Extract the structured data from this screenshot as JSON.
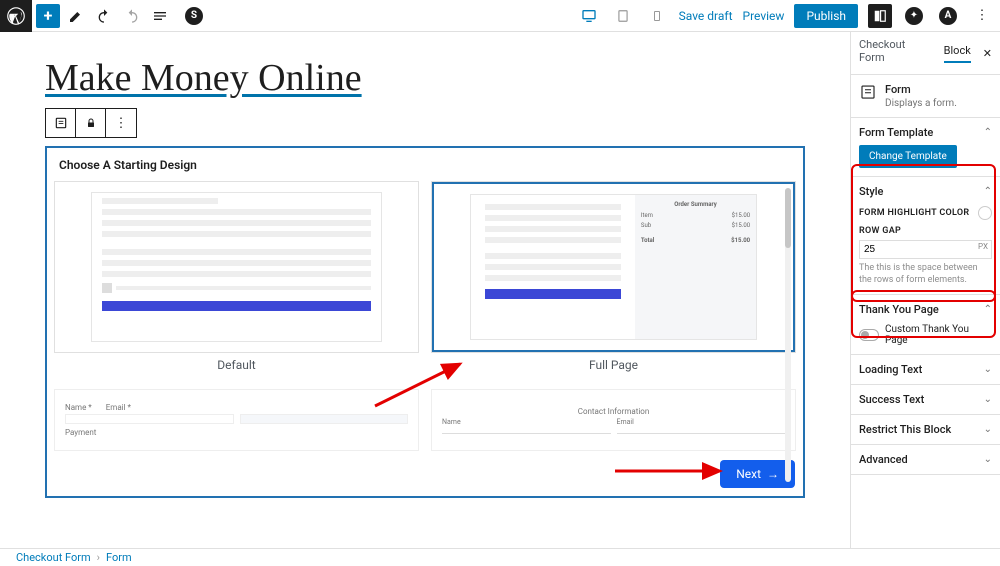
{
  "topbar": {
    "save_draft": "Save draft",
    "preview": "Preview",
    "publish": "Publish"
  },
  "page": {
    "title": "Make Money Online"
  },
  "block": {
    "heading": "Choose A Starting Design",
    "designs": {
      "default": "Default",
      "full_page": "Full Page"
    },
    "next": "Next"
  },
  "sidebar": {
    "tabs": {
      "checkout": "Checkout Form",
      "block": "Block"
    },
    "form_block": {
      "title": "Form",
      "desc": "Displays a form."
    },
    "panels": {
      "form_template": {
        "title": "Form Template",
        "change_btn": "Change Template"
      },
      "style": {
        "title": "Style",
        "highlight_label": "FORM HIGHLIGHT COLOR",
        "rowgap_label": "ROW GAP",
        "rowgap_value": "25",
        "rowgap_unit": "PX",
        "rowgap_help": "The this is the space between the rows of form elements."
      },
      "thank_you": {
        "title": "Thank You Page",
        "toggle_label": "Custom Thank You Page"
      },
      "loading_text": "Loading Text",
      "success_text": "Success Text",
      "restrict": "Restrict This Block",
      "advanced": "Advanced"
    }
  },
  "breadcrumb": {
    "parent": "Checkout Form",
    "current": "Form"
  }
}
